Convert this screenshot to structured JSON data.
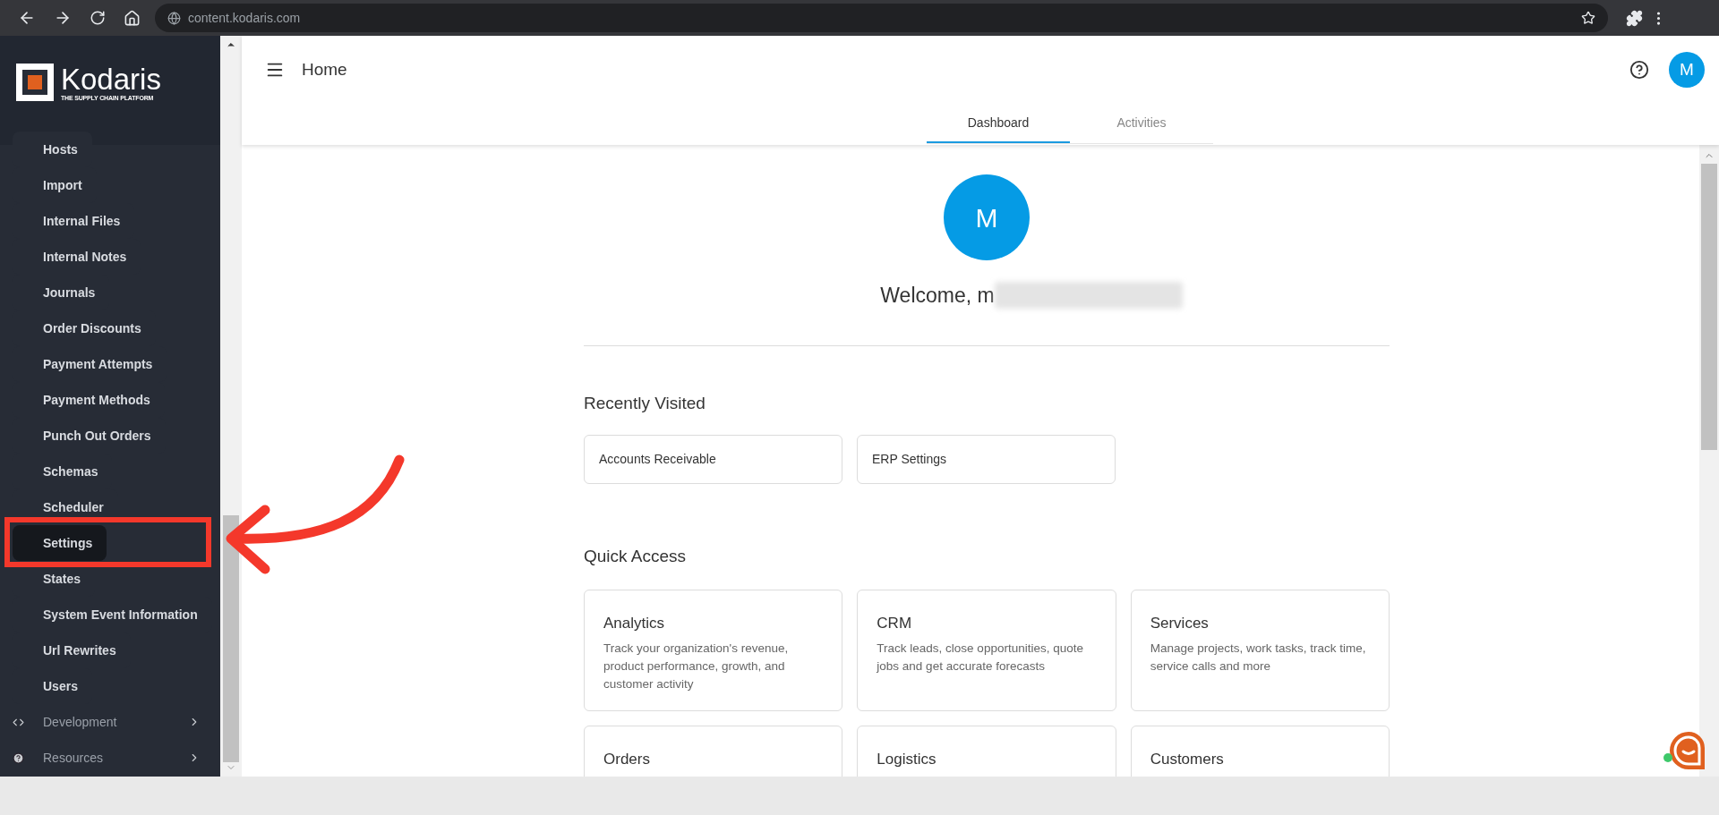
{
  "browser": {
    "url": "content.kodaris.com"
  },
  "sidebar": {
    "logo": {
      "name": "Kodaris",
      "tagline": "THE SUPPLY CHAIN PLATFORM"
    },
    "items": [
      {
        "label": "Hosts",
        "selected": false
      },
      {
        "label": "Import",
        "selected": false
      },
      {
        "label": "Internal Files",
        "selected": false
      },
      {
        "label": "Internal Notes",
        "selected": false
      },
      {
        "label": "Journals",
        "selected": false
      },
      {
        "label": "Order Discounts",
        "selected": false
      },
      {
        "label": "Payment Attempts",
        "selected": false
      },
      {
        "label": "Payment Methods",
        "selected": false
      },
      {
        "label": "Punch Out Orders",
        "selected": false
      },
      {
        "label": "Schemas",
        "selected": false
      },
      {
        "label": "Scheduler",
        "selected": false
      },
      {
        "label": "Settings",
        "selected": true
      },
      {
        "label": "States",
        "selected": false
      },
      {
        "label": "System Event Information",
        "selected": false
      },
      {
        "label": "Url Rewrites",
        "selected": false
      },
      {
        "label": "Users",
        "selected": false
      }
    ],
    "sections": [
      {
        "label": "Development",
        "kind": "code"
      },
      {
        "label": "Resources",
        "kind": "help"
      }
    ]
  },
  "header": {
    "title": "Home",
    "avatar": "M"
  },
  "tabs": [
    {
      "label": "Dashboard",
      "selected": true
    },
    {
      "label": "Activities",
      "selected": false
    }
  ],
  "welcome": {
    "avatar": "M",
    "text": "Welcome, m"
  },
  "recently_visited": {
    "title": "Recently Visited",
    "items": [
      "Accounts Receivable",
      "ERP Settings"
    ]
  },
  "quick_access": {
    "title": "Quick Access",
    "cards": [
      {
        "title": "Analytics",
        "description": "Track your organization's revenue, product performance, growth, and customer activity"
      },
      {
        "title": "CRM",
        "description": "Track leads, close opportunities, quote jobs and get accurate forecasts"
      },
      {
        "title": "Services",
        "description": "Manage projects, work tasks, track time, service calls and more"
      },
      {
        "title": "Orders"
      },
      {
        "title": "Logistics"
      },
      {
        "title": "Customers"
      }
    ]
  }
}
